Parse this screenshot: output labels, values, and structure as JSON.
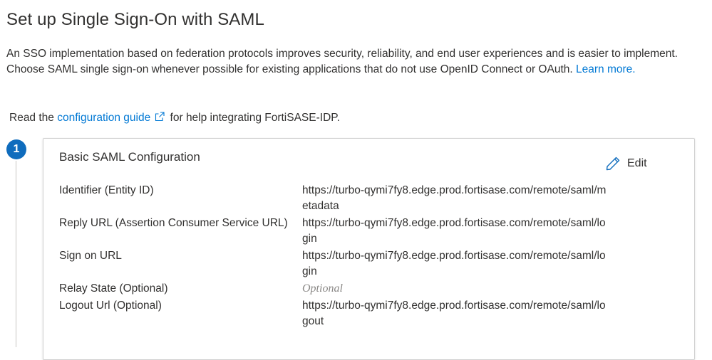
{
  "page": {
    "title": "Set up Single Sign-On with SAML",
    "intro_text": "An SSO implementation based on federation protocols improves security, reliability, and end user experiences and is easier to implement. Choose SAML single sign-on whenever possible for existing applications that do not use OpenID Connect or OAuth.",
    "learn_more": "Learn more.",
    "guide_prefix": "Read the",
    "guide_link": "configuration guide",
    "guide_suffix": "for help integrating FortiSASE-IDP."
  },
  "step": {
    "number": "1",
    "card_title": "Basic SAML Configuration",
    "edit_label": "Edit",
    "rows": [
      {
        "label": "Identifier (Entity ID)",
        "value": "https://turbo-qymi7fy8.edge.prod.fortisase.com/remote/saml/metadata"
      },
      {
        "label": "Reply URL (Assertion Consumer Service URL)",
        "value": "https://turbo-qymi7fy8.edge.prod.fortisase.com/remote/saml/login"
      },
      {
        "label": "Sign on URL",
        "value": "https://turbo-qymi7fy8.edge.prod.fortisase.com/remote/saml/login"
      },
      {
        "label": "Relay State (Optional)",
        "value": "Optional"
      },
      {
        "label": "Logout Url (Optional)",
        "value": "https://turbo-qymi7fy8.edge.prod.fortisase.com/remote/saml/logout"
      }
    ]
  },
  "colors": {
    "link": "#0078d4",
    "badge": "#0f6cbd",
    "placeholder": "#8a8886"
  },
  "icons": {
    "external": "external-link-icon",
    "edit": "pencil-icon"
  }
}
